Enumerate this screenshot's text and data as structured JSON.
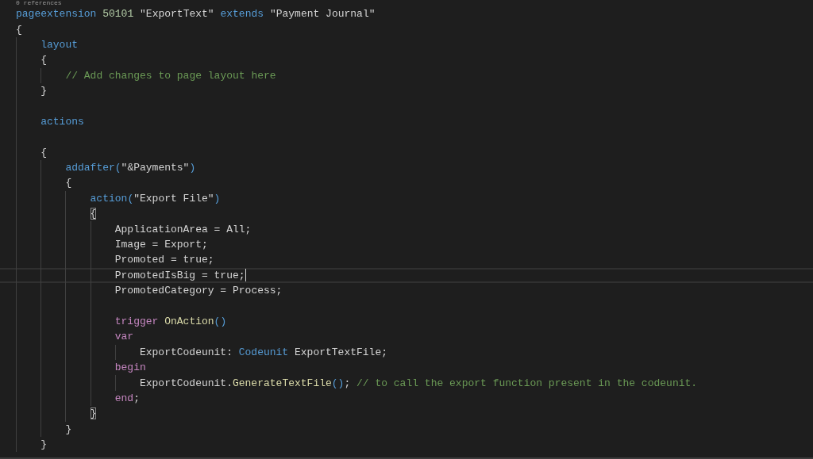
{
  "editor": {
    "codelens": "0 references",
    "lines": [
      {
        "kind": "code",
        "tokens": [
          {
            "kind": "keyword",
            "text": "pageextension "
          },
          {
            "kind": "number",
            "text": "50101 "
          },
          {
            "kind": "string",
            "text": "\"ExportText\" "
          },
          {
            "kind": "keyword",
            "text": "extends "
          },
          {
            "kind": "string",
            "text": "\"Payment Journal\""
          }
        ]
      },
      {
        "kind": "code",
        "tokens": [
          {
            "kind": "bracket",
            "text": "{"
          }
        ],
        "children": [
          {
            "kind": "code",
            "tokens": [
              {
                "kind": "keyword",
                "text": "layout"
              }
            ]
          },
          {
            "kind": "code",
            "tokens": [
              {
                "kind": "bracket",
                "text": "{"
              }
            ],
            "children": [
              {
                "kind": "code",
                "tokens": [
                  {
                    "kind": "comment",
                    "text": "// Add changes to page layout here"
                  }
                ]
              }
            ]
          },
          {
            "kind": "code",
            "tokens": [
              {
                "kind": "bracket",
                "text": "}"
              }
            ]
          },
          {
            "kind": "blank"
          },
          {
            "kind": "code",
            "tokens": [
              {
                "kind": "keyword",
                "text": "actions"
              }
            ]
          },
          {
            "kind": "blank"
          },
          {
            "kind": "code",
            "tokens": [
              {
                "kind": "bracket",
                "text": "{"
              }
            ],
            "children": [
              {
                "kind": "code",
                "tokens": [
                  {
                    "kind": "keyword",
                    "text": "addafter"
                  },
                  {
                    "kind": "paren",
                    "text": "("
                  },
                  {
                    "kind": "string",
                    "text": "\"&Payments\""
                  },
                  {
                    "kind": "paren",
                    "text": ")"
                  }
                ]
              },
              {
                "kind": "code",
                "tokens": [
                  {
                    "kind": "bracket",
                    "text": "{"
                  }
                ],
                "children": [
                  {
                    "kind": "code",
                    "tokens": [
                      {
                        "kind": "keyword",
                        "text": "action"
                      },
                      {
                        "kind": "paren",
                        "text": "("
                      },
                      {
                        "kind": "string",
                        "text": "\"Export File\""
                      },
                      {
                        "kind": "paren",
                        "text": ")"
                      }
                    ]
                  },
                  {
                    "kind": "code",
                    "tokens": [
                      {
                        "kind": "bracket",
                        "text": "{",
                        "matched": true
                      }
                    ],
                    "children": [
                      {
                        "kind": "code",
                        "tokens": [
                          {
                            "kind": "plain",
                            "text": "ApplicationArea = All;"
                          }
                        ]
                      },
                      {
                        "kind": "code",
                        "tokens": [
                          {
                            "kind": "plain",
                            "text": "Image = Export;"
                          }
                        ]
                      },
                      {
                        "kind": "code",
                        "tokens": [
                          {
                            "kind": "plain",
                            "text": "Promoted = true;"
                          }
                        ]
                      },
                      {
                        "kind": "code",
                        "current": true,
                        "tokens": [
                          {
                            "kind": "plain",
                            "text": "PromotedIsBig = true;"
                          }
                        ]
                      },
                      {
                        "kind": "code",
                        "tokens": [
                          {
                            "kind": "plain",
                            "text": "PromotedCategory = Process;"
                          }
                        ]
                      },
                      {
                        "kind": "blank"
                      },
                      {
                        "kind": "code",
                        "tokens": [
                          {
                            "kind": "control",
                            "text": "trigger "
                          },
                          {
                            "kind": "function",
                            "text": "OnAction"
                          },
                          {
                            "kind": "paren",
                            "text": "()"
                          }
                        ]
                      },
                      {
                        "kind": "code",
                        "tokens": [
                          {
                            "kind": "control",
                            "text": "var"
                          }
                        ],
                        "children": [
                          {
                            "kind": "code",
                            "tokens": [
                              {
                                "kind": "plain",
                                "text": "ExportCodeunit: "
                              },
                              {
                                "kind": "keyword",
                                "text": "Codeunit"
                              },
                              {
                                "kind": "plain",
                                "text": " ExportTextFile;"
                              }
                            ]
                          }
                        ]
                      },
                      {
                        "kind": "code",
                        "tokens": [
                          {
                            "kind": "control",
                            "text": "begin"
                          }
                        ],
                        "children": [
                          {
                            "kind": "code",
                            "tokens": [
                              {
                                "kind": "plain",
                                "text": "ExportCodeunit."
                              },
                              {
                                "kind": "function",
                                "text": "GenerateTextFile"
                              },
                              {
                                "kind": "paren",
                                "text": "()"
                              },
                              {
                                "kind": "plain",
                                "text": "; "
                              },
                              {
                                "kind": "comment",
                                "text": "// to call the export function present in the codeunit."
                              }
                            ]
                          }
                        ]
                      },
                      {
                        "kind": "code",
                        "tokens": [
                          {
                            "kind": "control",
                            "text": "end"
                          },
                          {
                            "kind": "plain",
                            "text": ";"
                          }
                        ]
                      }
                    ]
                  },
                  {
                    "kind": "code",
                    "tokens": [
                      {
                        "kind": "bracket",
                        "text": "}",
                        "matched": true
                      }
                    ]
                  }
                ]
              },
              {
                "kind": "code",
                "tokens": [
                  {
                    "kind": "bracket",
                    "text": "}"
                  }
                ]
              }
            ]
          },
          {
            "kind": "code",
            "tokens": [
              {
                "kind": "bracket",
                "text": "}"
              }
            ]
          }
        ]
      }
    ]
  }
}
